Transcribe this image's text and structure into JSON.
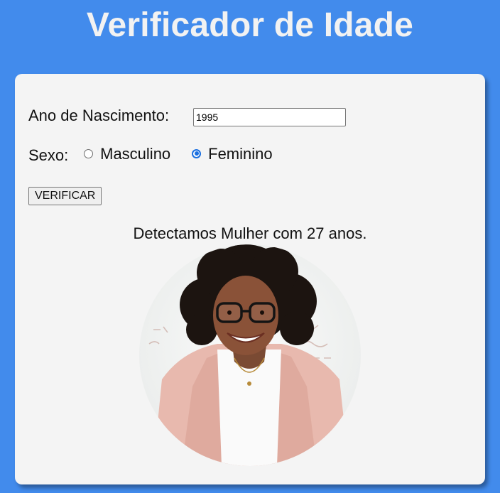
{
  "header": {
    "title": "Verificador de Idade"
  },
  "form": {
    "year_label": "Ano de Nascimento:",
    "year_value": "1995",
    "sex_label": "Sexo:",
    "options": [
      {
        "label": "Masculino",
        "checked": false
      },
      {
        "label": "Feminino",
        "checked": true
      }
    ],
    "verify_label": "VERIFICAR"
  },
  "result": {
    "text": "Detectamos Mulher com 27 anos.",
    "image": "woman-photo"
  },
  "colors": {
    "background": "#428bec",
    "card": "#f4f4f4",
    "title": "#f2f2f2",
    "radio_checked": "#1a6fe0"
  }
}
